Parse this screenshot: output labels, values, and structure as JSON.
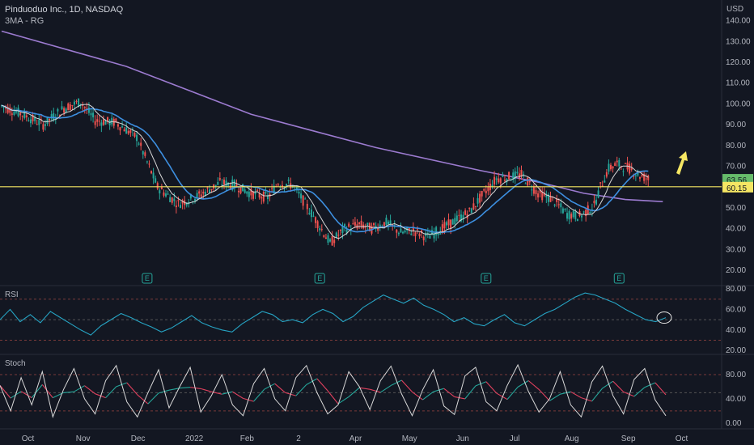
{
  "header": {
    "symbol_line": "Pinduoduo Inc., 1D, NASDAQ",
    "indicator_line": "3MA - RG"
  },
  "price_axis": {
    "currency": "USD",
    "ticks": [
      "140.00",
      "130.00",
      "120.00",
      "110.00",
      "100.00",
      "90.00",
      "80.00",
      "70.00",
      "60.00",
      "50.00",
      "40.00",
      "30.00",
      "20.00"
    ],
    "last_price_label": "63.56",
    "level_label": "60.15"
  },
  "time_axis": {
    "labels": [
      "Oct",
      "Nov",
      "Dec",
      "2022",
      "Feb",
      "2",
      "Apr",
      "May",
      "Jun",
      "Jul",
      "Aug",
      "Sep",
      "Oct"
    ]
  },
  "rsi_pane": {
    "title": "RSI",
    "ticks": [
      "80.00",
      "60.00",
      "40.00",
      "20.00"
    ]
  },
  "stoch_pane": {
    "title": "Stoch",
    "ticks": [
      "80.00",
      "40.00",
      "0.00"
    ]
  },
  "earnings_marker": "E",
  "colors": {
    "background": "#131722",
    "up": "#26a69a",
    "down": "#ef5350",
    "ma_long": "#9c7bd0",
    "ma_mid": "#3d8fe0",
    "ma_short": "#d8d8d8",
    "level_line": "#f5e663",
    "last_price_badge": "#66bb6a",
    "level_badge": "#f5e663",
    "rsi_line": "#26a4c4",
    "stoch_k": "#d8d8d8",
    "stoch_d_up": "#26a69a",
    "stoch_d_down": "#e0415e",
    "arrow": "#f5e663"
  },
  "chart_data": {
    "type": "candlestick",
    "level": 60.15,
    "last_price": 63.56,
    "ylim": [
      15,
      148
    ],
    "x_month_labels": [
      "Oct",
      "Nov",
      "Dec",
      "2022",
      "Feb",
      "2",
      "Apr",
      "May",
      "Jun",
      "Jul",
      "Aug",
      "Sep",
      "Oct"
    ],
    "earnings_days": [
      70,
      153,
      233,
      297
    ],
    "price_path": [
      [
        0,
        99
      ],
      [
        10,
        95
      ],
      [
        20,
        90
      ],
      [
        30,
        98
      ],
      [
        38,
        101
      ],
      [
        45,
        92
      ],
      [
        55,
        91
      ],
      [
        65,
        84
      ],
      [
        75,
        60
      ],
      [
        85,
        52
      ],
      [
        95,
        56
      ],
      [
        105,
        62
      ],
      [
        112,
        61
      ],
      [
        120,
        57
      ],
      [
        128,
        55
      ],
      [
        133,
        62
      ],
      [
        140,
        61
      ],
      [
        150,
        46
      ],
      [
        158,
        33
      ],
      [
        165,
        40
      ],
      [
        172,
        42
      ],
      [
        178,
        40
      ],
      [
        185,
        43
      ],
      [
        192,
        38
      ],
      [
        198,
        39
      ],
      [
        205,
        36
      ],
      [
        215,
        42
      ],
      [
        225,
        48
      ],
      [
        232,
        57
      ],
      [
        238,
        64
      ],
      [
        245,
        65
      ],
      [
        250,
        66
      ],
      [
        258,
        57
      ],
      [
        265,
        54
      ],
      [
        272,
        47
      ],
      [
        278,
        46
      ],
      [
        285,
        51
      ],
      [
        288,
        60
      ],
      [
        292,
        69
      ],
      [
        296,
        71
      ],
      [
        302,
        69
      ],
      [
        306,
        66
      ],
      [
        311,
        64
      ]
    ],
    "ma_long": [
      [
        0,
        135
      ],
      [
        60,
        118
      ],
      [
        120,
        95
      ],
      [
        180,
        79
      ],
      [
        230,
        68
      ],
      [
        260,
        62
      ],
      [
        280,
        57
      ],
      [
        300,
        54
      ],
      [
        318,
        53
      ]
    ],
    "rsi": [
      50,
      60,
      48,
      55,
      47,
      58,
      52,
      46,
      40,
      35,
      44,
      50,
      56,
      52,
      47,
      43,
      38,
      42,
      48,
      54,
      47,
      43,
      40,
      38,
      46,
      52,
      58,
      55,
      48,
      50,
      47,
      55,
      60,
      56,
      48,
      53,
      62,
      68,
      74,
      70,
      66,
      71,
      64,
      60,
      55,
      48,
      52,
      46,
      44,
      50,
      55,
      47,
      44,
      50,
      56,
      60,
      66,
      72,
      76,
      74,
      70,
      66,
      60,
      55,
      50,
      48,
      52
    ],
    "stoch_k": [
      62,
      20,
      75,
      30,
      85,
      10,
      55,
      90,
      40,
      15,
      70,
      95,
      35,
      10,
      50,
      88,
      25,
      60,
      92,
      18,
      45,
      80,
      30,
      12,
      65,
      90,
      40,
      20,
      75,
      95,
      50,
      15,
      30,
      85,
      60,
      22,
      70,
      94,
      48,
      12,
      55,
      88,
      28,
      14,
      78,
      92,
      35,
      20,
      62,
      96,
      52,
      18,
      40,
      85,
      30,
      10,
      68,
      94,
      45,
      15,
      72,
      90,
      38,
      12
    ],
    "stoch_d_pattern": "smoothed stoch_k"
  }
}
